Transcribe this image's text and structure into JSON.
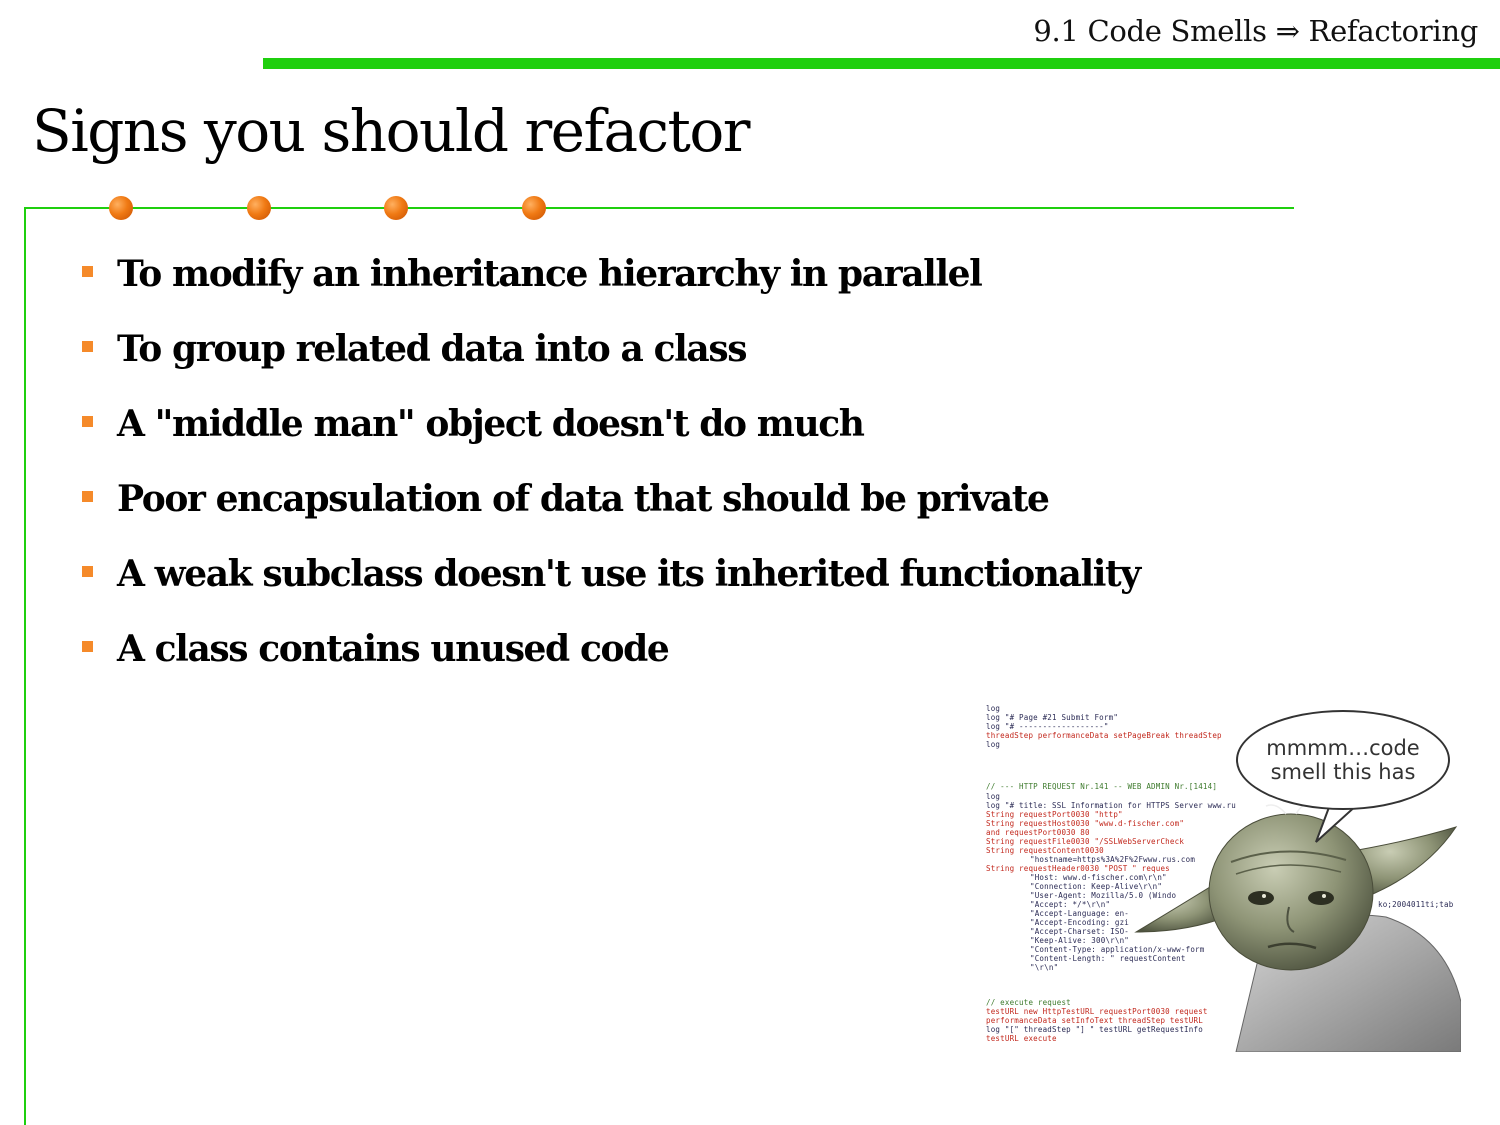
{
  "header": {
    "section_title": "9.1 Code Smells ⇒ Refactoring"
  },
  "slide": {
    "title": "Signs you should refactor",
    "bullets": [
      "To modify an inheritance hierarchy in parallel",
      "To group related data into a class",
      "A \"middle man\" object doesn't do much",
      "Poor encapsulation of data that should be private",
      "A weak subclass doesn't use its inherited functionality",
      "A class contains unused code"
    ]
  },
  "picture": {
    "speech_bubble": [
      "mmmm…code",
      "smell this has"
    ]
  },
  "colors": {
    "accent_green": "#1fcf0e",
    "bullet_orange": "#f58a2a"
  }
}
